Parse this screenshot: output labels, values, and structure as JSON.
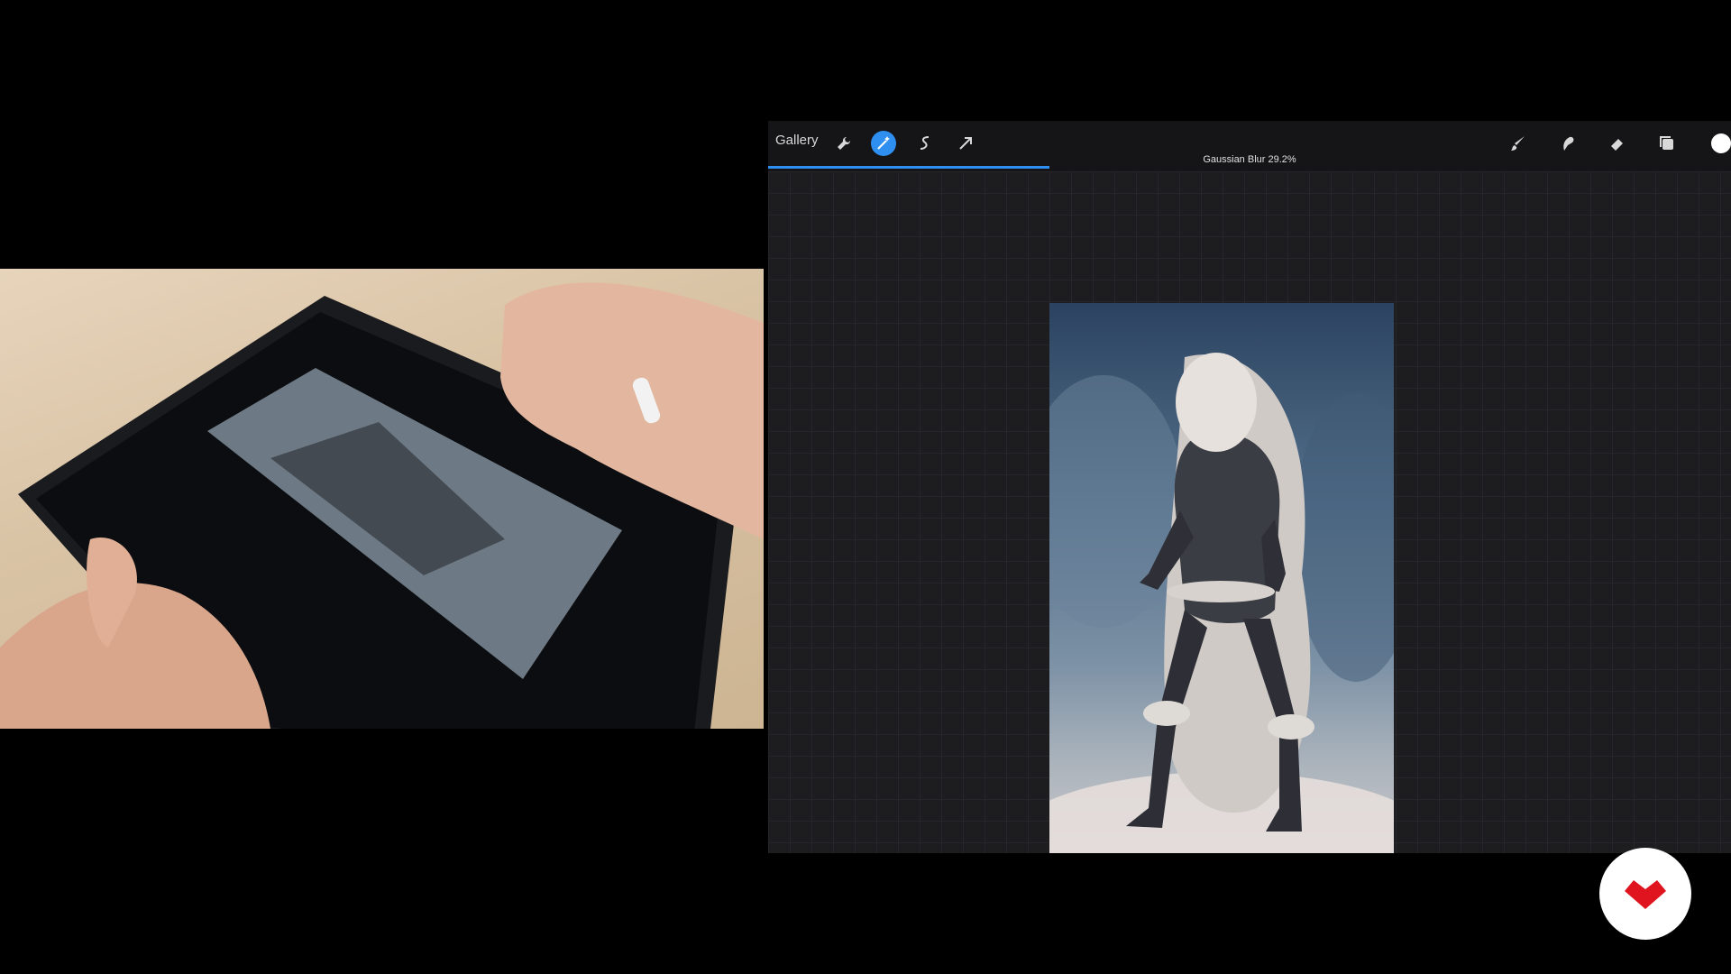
{
  "toolbar": {
    "gallery_label": "Gallery",
    "icons": [
      "wrench-icon",
      "magic-wand-icon",
      "selection-icon",
      "transform-arrow-icon",
      "brush-icon",
      "smudge-icon",
      "eraser-icon",
      "layers-icon",
      "color-swatch"
    ]
  },
  "adjustment": {
    "status": "Gaussian Blur 29.2%",
    "value_percent": 29.2
  },
  "colors": {
    "accent": "#2f8ff0",
    "background": "#1d1c1f",
    "brand": "#e0141e"
  }
}
